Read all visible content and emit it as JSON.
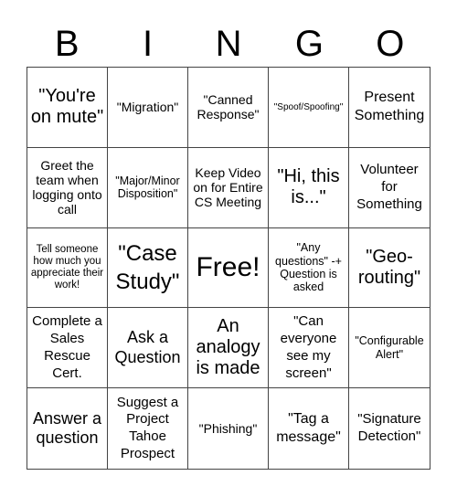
{
  "header": {
    "letters": [
      "B",
      "I",
      "N",
      "G",
      "O"
    ]
  },
  "cells": [
    "\"You're on mute\"",
    "\"Migration\"",
    "\"Canned Response\"",
    "\"Spoof/Spoofing\"",
    "Present Something",
    "Greet the team when logging onto call",
    "\"Major/Minor Disposition\"",
    "Keep Video on for Entire CS Meeting",
    "\"Hi, this is...\"",
    "Volunteer for Something",
    "Tell someone how much you appreciate their work!",
    "\"Case Study\"",
    "Free!",
    "\"Any questions\" -+ Question is asked",
    "\"Geo-routing\"",
    "Complete a Sales Rescue Cert.",
    "Ask a Question",
    "An analogy is made",
    "\"Can everyone see my screen\"",
    "\"Configurable Alert\"",
    "Answer a question",
    "Suggest a Project Tahoe Prospect",
    "\"Phishing\"",
    "\"Tag a message\"",
    "\"Signature Detection\""
  ]
}
